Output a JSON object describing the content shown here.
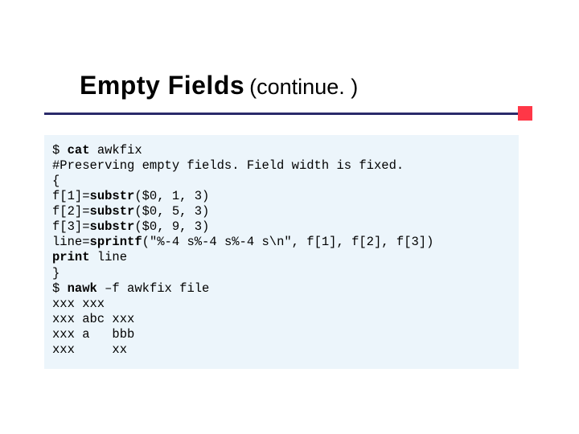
{
  "title": {
    "main": "Empty Fields",
    "cont": "(continue. )"
  },
  "code": {
    "l0": "$ cat awkfix",
    "l1": "#Preserving empty fields. Field width is fixed.",
    "l2": "{",
    "l3": "f[1]=substr($0, 1, 3)",
    "l4": "f[2]=substr($0, 5, 3)",
    "l5": "f[3]=substr($0, 9, 3)",
    "l6": "line=sprintf(\"%-4 s%-4 s%-4 s\\n\", f[1], f[2], f[3])",
    "l7": "print line",
    "l8": "}",
    "l9": "$ nawk –f awkfix file",
    "l10": "xxx xxx",
    "l11": "xxx abc xxx",
    "l12": "xxx a   bbb",
    "l13": "xxx     xx"
  }
}
